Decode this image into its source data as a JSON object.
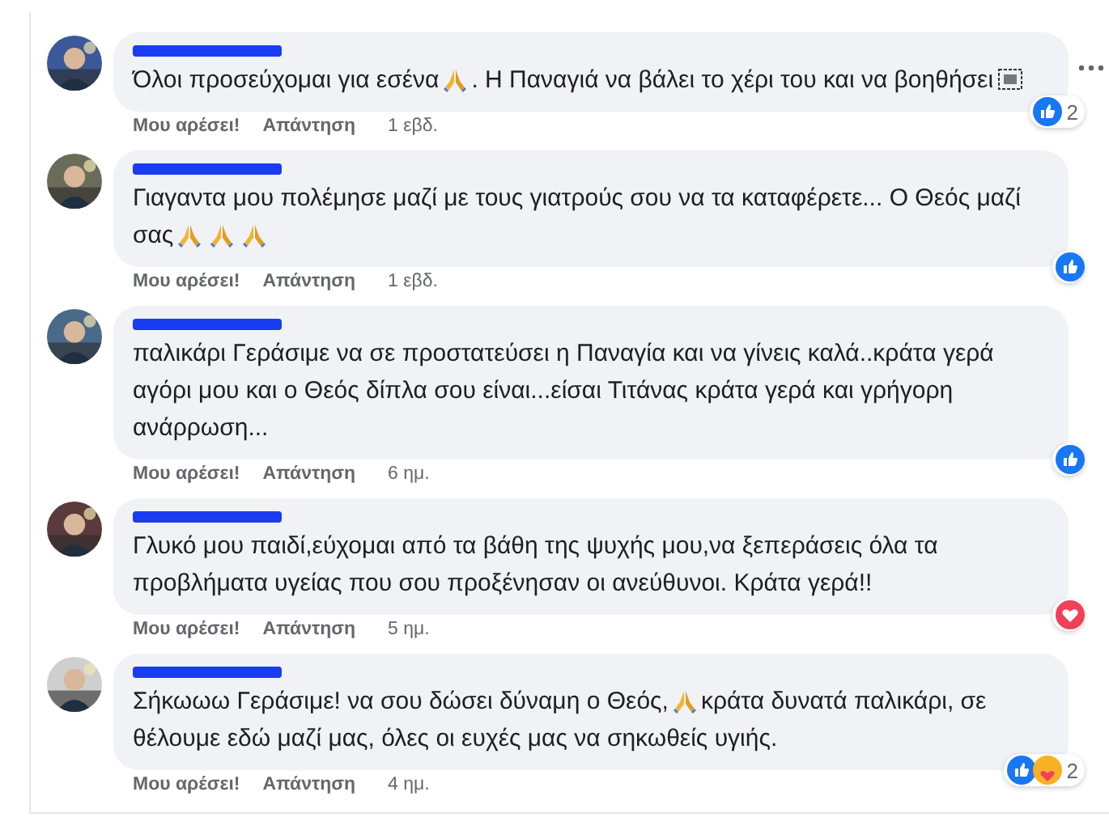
{
  "comments": [
    {
      "avatar": {
        "kind": "picture"
      },
      "lines": [
        [
          {
            "kind": "text",
            "text": "Όλοι προσεύχομαι για εσένα"
          },
          {
            "kind": "pray"
          },
          {
            "kind": "text",
            "text": ". Η Παναγιά να βάλει το χέρι του και να βοηθήσει"
          },
          {
            "kind": "glyph"
          }
        ]
      ],
      "actions": [
        "Μου αρέσει!",
        "Απάντηση"
      ],
      "time": "1 εβδ.",
      "reactions": [
        {
          "kind": "like"
        }
      ],
      "reaction_count": "2",
      "menu": true
    },
    {
      "avatar": {
        "kind": "picture"
      },
      "lines": [
        [
          {
            "kind": "text",
            "text": "Γιαγαντα μου πολέμησε μαζί με τους γιατρούς σου να τα καταφέρετε... Ο Θεός μαζί"
          }
        ],
        [
          {
            "kind": "text",
            "text": "σας"
          },
          {
            "kind": "pray"
          },
          {
            "kind": "pray"
          },
          {
            "kind": "pray"
          }
        ]
      ],
      "actions": [
        "Μου αρέσει!",
        "Απάντηση"
      ],
      "time": "1 εβδ.",
      "reactions": [
        {
          "kind": "like"
        }
      ],
      "menu": false
    },
    {
      "avatar": {
        "kind": "picture"
      },
      "lines": [
        [
          {
            "kind": "text",
            "text": "παλικάρι Γεράσιμε να σε προστατεύσει η Παναγία και να γίνεις καλά..κράτα γερά"
          }
        ],
        [
          {
            "kind": "text",
            "text": "αγόρι μου και ο Θεός δίπλα σου είναι...είσαι Τιτάνας κράτα γερά και γρήγορη"
          }
        ],
        [
          {
            "kind": "text",
            "text": "ανάρρωση..."
          }
        ]
      ],
      "actions": [
        "Μου αρέσει!",
        "Απάντηση"
      ],
      "time": "6 ημ.",
      "reactions": [
        {
          "kind": "like"
        }
      ],
      "menu": false
    },
    {
      "avatar": {
        "kind": "picture"
      },
      "lines": [
        [
          {
            "kind": "text",
            "text": "Γλυκό μου παιδί,εύχομαι από τα βάθη της ψυχής μου,να ξεπεράσεις όλα τα"
          }
        ],
        [
          {
            "kind": "text",
            "text": "προβλήματα υγείας που σου προξένησαν οι ανεύθυνοι. Κράτα γερά!!"
          }
        ]
      ],
      "actions": [
        "Μου αρέσει!",
        "Απάντηση"
      ],
      "time": "5 ημ.",
      "reactions": [
        {
          "kind": "love"
        }
      ],
      "menu": false
    },
    {
      "avatar": {
        "kind": "picture"
      },
      "lines": [
        [
          {
            "kind": "text",
            "text": "Σήκωωω Γεράσιμε! να σου δώσει δύναμη ο Θεός,"
          },
          {
            "kind": "pray"
          },
          {
            "kind": "text",
            "text": "κράτα δυνατά παλικάρι, σε"
          }
        ],
        [
          {
            "kind": "text",
            "text": "θέλουμε εδώ μαζί μας, όλες οι ευχές μας να σηκωθείς υγιής."
          }
        ]
      ],
      "actions": [
        "Μου αρέσει!",
        "Απάντηση"
      ],
      "time": "4 ημ.",
      "reactions": [
        {
          "kind": "like"
        },
        {
          "kind": "care"
        }
      ],
      "reaction_count": "2",
      "menu": false
    }
  ]
}
